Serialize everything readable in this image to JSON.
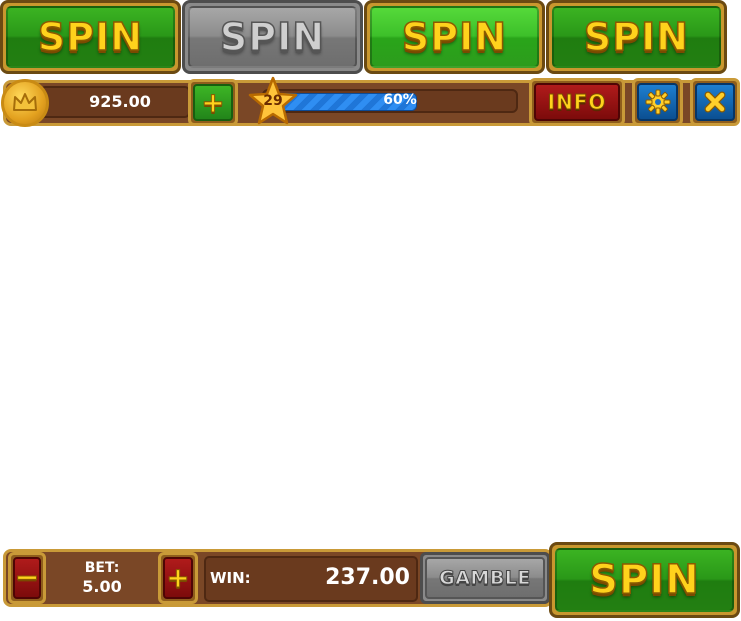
{
  "spin_buttons": [
    {
      "label": "SPIN",
      "state": "normal"
    },
    {
      "label": "SPIN",
      "state": "disabled"
    },
    {
      "label": "SPIN",
      "state": "hover"
    },
    {
      "label": "SPIN",
      "state": "pressed"
    }
  ],
  "header": {
    "coin_icon": "crown-coin-icon",
    "balance": "925.00",
    "add_icon": "plus-icon",
    "level": "29",
    "xp_percent_label": "60%",
    "xp_progress": 0.6,
    "info_label": "INFO",
    "settings_icon": "gear-icon",
    "close_icon": "close-icon"
  },
  "footer": {
    "bet_label": "BET:",
    "bet_value": "5.00",
    "win_label": "WIN:",
    "win_value": "237.00",
    "gamble_label": "GAMBLE",
    "spin_label": "SPIN"
  },
  "colors": {
    "gold": "#ffd21c",
    "wood": "#7a4726",
    "spin_green": "#2a9818",
    "disabled_gray": "#8c8c8c",
    "xp_blue": "#2f8ef2",
    "info_red": "#b01b1b",
    "icon_blue": "#1e7fd0"
  }
}
